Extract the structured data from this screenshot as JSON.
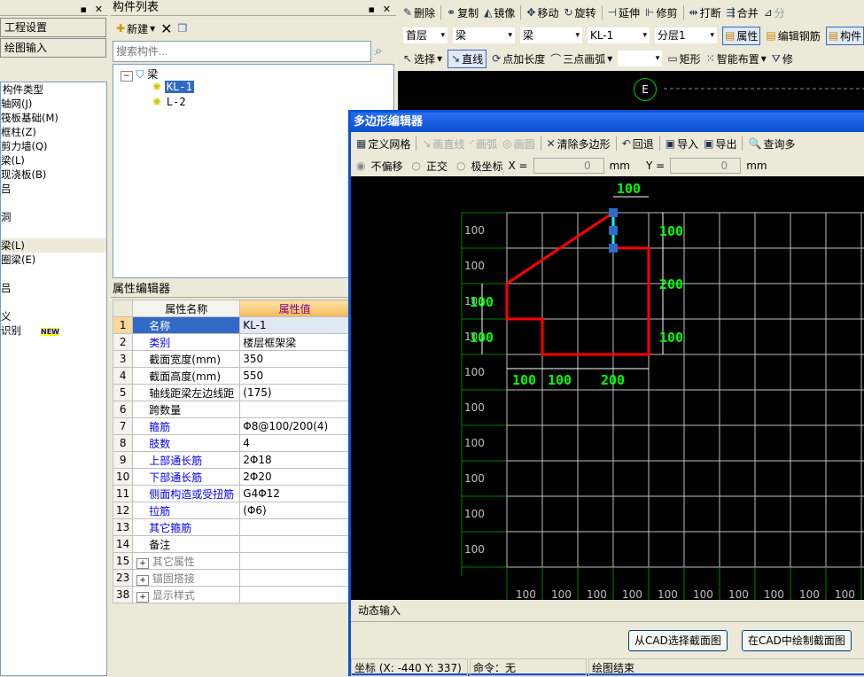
{
  "left_panel": {
    "nav": [
      "工程设置",
      "绘图输入"
    ],
    "tree": [
      "构件类型",
      "轴网(J)",
      "筏板基础(M)",
      "框柱(Z)",
      "剪力墙(Q)",
      "梁(L)",
      "现浇板(B)",
      "吕",
      "",
      "洞",
      "",
      "梁(L)",
      "圈梁(E)",
      "",
      "吕",
      "",
      "义",
      "识别"
    ],
    "new_badge": "NEW"
  },
  "component_list": {
    "title": "构件列表",
    "new_label": "新建",
    "search_placeholder": "搜索构件...",
    "root": "梁",
    "items": [
      "KL-1",
      "L-2"
    ],
    "selected": "KL-1"
  },
  "property_editor": {
    "title": "属性编辑器",
    "headers": [
      "属性名称",
      "属性值"
    ],
    "rows": [
      {
        "n": "1",
        "name": "名称",
        "value": "KL-1",
        "style": "sel"
      },
      {
        "n": "2",
        "name": "类别",
        "value": "楼层框架梁",
        "style": "blue"
      },
      {
        "n": "3",
        "name": "截面宽度(mm)",
        "value": "350",
        "style": ""
      },
      {
        "n": "4",
        "name": "截面高度(mm)",
        "value": "550",
        "style": ""
      },
      {
        "n": "5",
        "name": "轴线距梁左边线距",
        "value": "(175)",
        "style": ""
      },
      {
        "n": "6",
        "name": "跨数量",
        "value": "",
        "style": ""
      },
      {
        "n": "7",
        "name": "箍筋",
        "value": "Φ8@100/200(4)",
        "style": "blue"
      },
      {
        "n": "8",
        "name": "肢数",
        "value": "4",
        "style": "blue"
      },
      {
        "n": "9",
        "name": "上部通长筋",
        "value": "2Φ18",
        "style": "blue"
      },
      {
        "n": "10",
        "name": "下部通长筋",
        "value": "2Φ20",
        "style": "blue"
      },
      {
        "n": "11",
        "name": "侧面构造或受扭筋",
        "value": "G4Φ12",
        "style": "blue"
      },
      {
        "n": "12",
        "name": "拉筋",
        "value": "(Φ6)",
        "style": "blue"
      },
      {
        "n": "13",
        "name": "其它箍筋",
        "value": "",
        "style": "blue"
      },
      {
        "n": "14",
        "name": "备注",
        "value": "",
        "style": ""
      },
      {
        "n": "15",
        "name": "其它属性",
        "value": "",
        "style": "grey"
      },
      {
        "n": "23",
        "name": "锚固搭接",
        "value": "",
        "style": "grey"
      },
      {
        "n": "38",
        "name": "显示样式",
        "value": "",
        "style": "grey"
      }
    ]
  },
  "main_toolbar": {
    "row1": [
      "删除",
      "复制",
      "镜像",
      "移动",
      "旋转",
      "延伸",
      "修剪",
      "打断",
      "合并",
      "分"
    ],
    "selects": [
      "首层",
      "梁",
      "梁",
      "KL-1",
      "分层1"
    ],
    "row2_buttons": [
      "属性",
      "编辑钢筋",
      "构件"
    ],
    "row3": [
      "选择",
      "直线",
      "点加长度",
      "三点画弧",
      "矩形",
      "智能布置",
      "修"
    ],
    "axis_label": "E"
  },
  "dialog": {
    "title": "多边形编辑器",
    "toolbar": [
      "定义网格",
      "画直线",
      "画弧",
      "画圆",
      "清除多边形",
      "回退",
      "导入",
      "导出",
      "查询多"
    ],
    "radios": [
      "不偏移",
      "正交",
      "极坐标"
    ],
    "x_label": "X =",
    "x_value": "0",
    "y_label": "Y =",
    "y_value": "0",
    "unit": "mm",
    "grid_labels": "100",
    "dims": {
      "top": "100",
      "right": [
        "100",
        "200",
        "100"
      ],
      "left": [
        "100",
        "100"
      ],
      "bottom": [
        "100",
        "100",
        "200"
      ]
    },
    "tab": "动态输入",
    "buttons": [
      "从CAD选择截面图",
      "在CAD中绘制截面图"
    ],
    "status": {
      "coords": "坐标 (X: -440 Y: 337)",
      "command": "命令：无",
      "message": "绘图结束"
    },
    "colors": {
      "shape": "#ff0000",
      "dim_text": "#00ff00",
      "grid": "#c0c0c0",
      "axis": "#008000",
      "selected_edge": "#00ffff"
    }
  }
}
